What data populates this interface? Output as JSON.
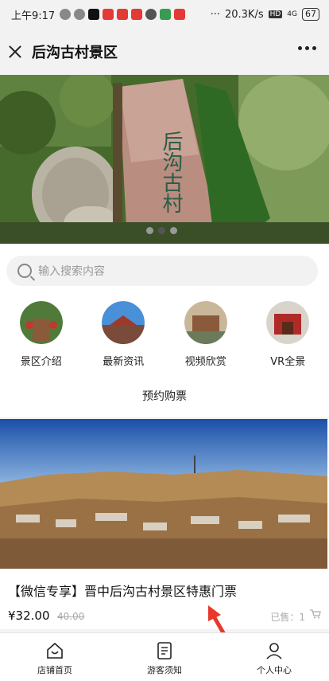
{
  "status_bar": {
    "time": "上午9:17",
    "speed": "20.3K/s",
    "network": "4G",
    "battery": "67"
  },
  "titlebar": {
    "title": "后沟古村景区"
  },
  "banner": {
    "inscription": "后沟古村",
    "slide_count": 3,
    "active_slide": 2
  },
  "search": {
    "placeholder": "输入搜索内容"
  },
  "nav": [
    {
      "label": "景区介绍"
    },
    {
      "label": "最新资讯"
    },
    {
      "label": "视频欣赏"
    },
    {
      "label": "VR全景"
    }
  ],
  "buy_link": "预约购票",
  "product": {
    "title": "【微信专享】晋中后沟古村景区特惠门票",
    "price": "¥32.00",
    "old_price": "40.00",
    "sold": "已售：1"
  },
  "tabbar": [
    {
      "label": "店铺首页",
      "icon": "home-icon"
    },
    {
      "label": "游客须知",
      "icon": "notice-icon"
    },
    {
      "label": "个人中心",
      "icon": "person-icon"
    }
  ],
  "colors": {
    "accent_arrow": "#e8382c",
    "banner_green": "#4a6b30"
  }
}
